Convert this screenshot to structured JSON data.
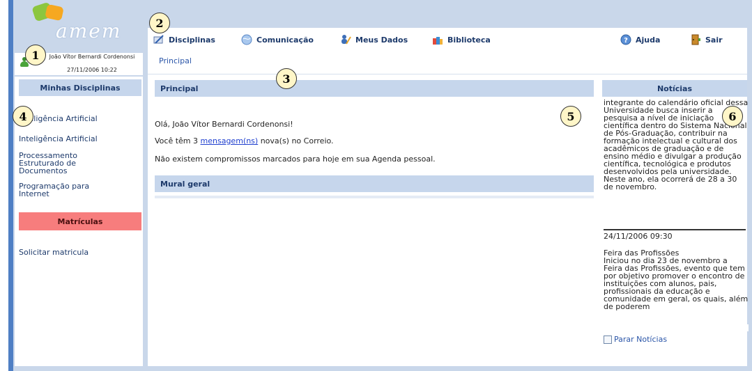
{
  "app": {
    "logo_text": "amem"
  },
  "user": {
    "name": "João Vítor Bernardi Cordenonsi",
    "datetime": "27/11/2006 10:22"
  },
  "nav": {
    "items": [
      {
        "label": "Disciplinas",
        "icon": "book-pen-icon"
      },
      {
        "label": "Comunicação",
        "icon": "globe-icon"
      },
      {
        "label": "Meus Dados",
        "icon": "user-edit-icon"
      },
      {
        "label": "Biblioteca",
        "icon": "library-books-icon"
      },
      {
        "label": "Ajuda",
        "icon": "help-icon"
      },
      {
        "label": "Sair",
        "icon": "exit-door-icon"
      }
    ]
  },
  "breadcrumb": "Principal",
  "sidebar": {
    "title": "Minhas Disciplinas",
    "courses": [
      "Inteligência Artificial",
      "Inteligência Artificial",
      "Processamento Estruturado de Documentos",
      "Programação para Internet"
    ],
    "enroll_title": "Matrículas",
    "enroll_link": "Solicitar matricula"
  },
  "main": {
    "title": "Principal",
    "greeting": "Olá, João Vítor Bernardi Cordenonsi!",
    "messages_prefix": "Você têm 3 ",
    "messages_link": "mensagem(ns)",
    "messages_suffix": " nova(s) no Correio.",
    "agenda": "Não existem compromissos marcados para hoje em sua Agenda pessoal.",
    "mural_title": "Mural geral"
  },
  "news": {
    "title": "Notícias",
    "item1_text": "integrante do calendário oficial dessa Universidade busca inserir a pesquisa a nível de iniciação científica dentro do Sistema Nacional de Pós-Graduação, contribuir na formação intelectual e cultural dos acadêmicos de graduação e de ensino médio e divulgar a produção científica, tecnológica e produtos desenvolvidos pela universidade. Neste ano, ela ocorrerá de 28 a 30 de novembro.",
    "item1_date": "24/11/2006 09:30",
    "item2_title": "Feira das Profissões",
    "item2_text": "Iniciou no dia 23 de novembro a Feira das Profissões, evento que tem por objetivo promover o encontro de instituições com alunos, pais, profissionais da educação e comunidade em geral, os quais, além de poderem",
    "stop_label": "Parar Notícias"
  },
  "callouts": [
    "1",
    "2",
    "3",
    "4",
    "5",
    "6"
  ],
  "colors": {
    "frame": "#c9d7ea",
    "header": "#c6d6ec",
    "accent": "#4f7fc4",
    "enroll": "#f77d7d",
    "link": "#1f3fcf"
  }
}
